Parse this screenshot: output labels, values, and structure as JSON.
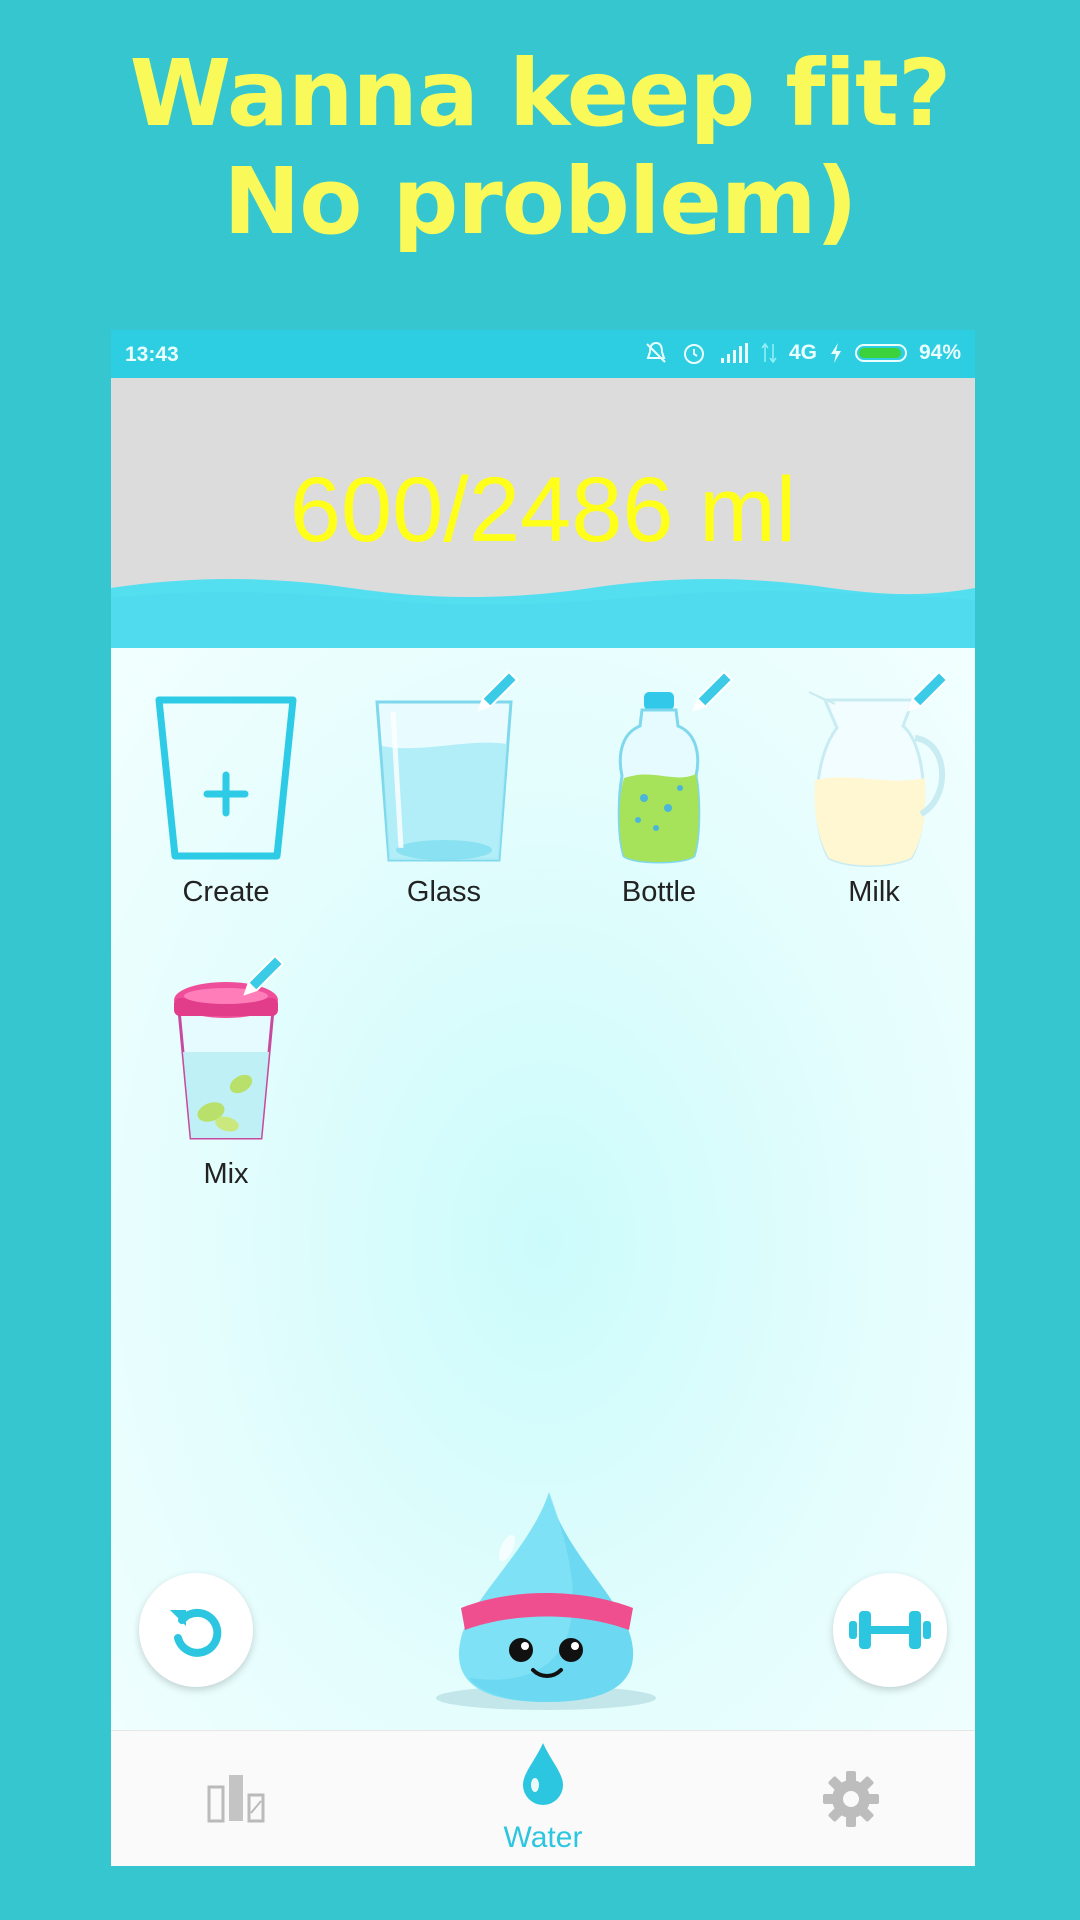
{
  "promo": {
    "line1": "Wanna keep fit?",
    "line2": "No problem)"
  },
  "status_bar": {
    "time": "13:43",
    "network": "4G",
    "battery": "94%",
    "battery_level": 0.94
  },
  "header": {
    "progress_text": "600/2486 ml",
    "progress_ratio": 0.241
  },
  "drinks": [
    {
      "label": "Create",
      "icon": "create-cup-icon"
    },
    {
      "label": "Glass",
      "icon": "glass-icon"
    },
    {
      "label": "Bottle",
      "icon": "bottle-icon"
    },
    {
      "label": "Milk",
      "icon": "milk-jug-icon"
    },
    {
      "label": "Mix",
      "icon": "mix-cup-icon"
    }
  ],
  "actions": {
    "undo_icon": "undo-icon",
    "workout_icon": "dumbbell-icon"
  },
  "nav": {
    "items": [
      {
        "label": "",
        "icon": "chart-icon"
      },
      {
        "label": "Water",
        "icon": "water-drop-icon"
      },
      {
        "label": "",
        "icon": "gear-icon"
      }
    ]
  },
  "colors": {
    "background": "#35c6cf",
    "accent": "#2dc6e0",
    "progress_text": "#ffff1a",
    "promo_text": "#f9f95a"
  }
}
